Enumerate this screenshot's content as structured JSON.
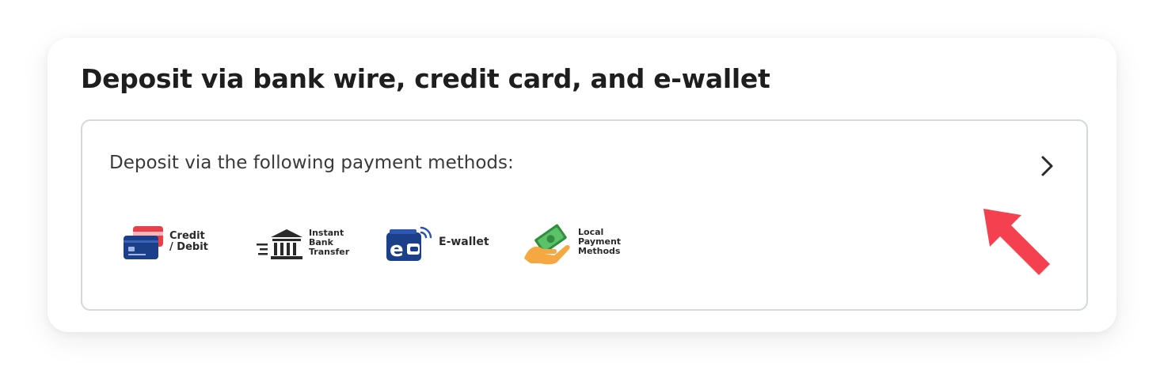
{
  "card": {
    "title": "Deposit via bank wire, credit card, and e-wallet"
  },
  "methods_box": {
    "text": "Deposit via the following payment methods:",
    "chevron_icon": "chevron-right-icon",
    "methods": [
      {
        "icon": "credit-card-icon",
        "lines": [
          "Credit",
          "/ Debit"
        ]
      },
      {
        "icon": "bank-icon",
        "lines": [
          "Instant",
          "Bank",
          "Transfer"
        ]
      },
      {
        "icon": "ewallet-icon",
        "lines": [
          "E-wallet"
        ]
      },
      {
        "icon": "cash-hand-icon",
        "lines": [
          "Local",
          "Payment",
          "Methods"
        ]
      }
    ]
  },
  "annotation": {
    "icon": "pointer-arrow-icon",
    "color": "#f4404f"
  },
  "colors": {
    "card_blue": "#1c3f8a",
    "card_red": "#e8404a",
    "money_green": "#4caf50",
    "hand_orange": "#f5a742"
  }
}
